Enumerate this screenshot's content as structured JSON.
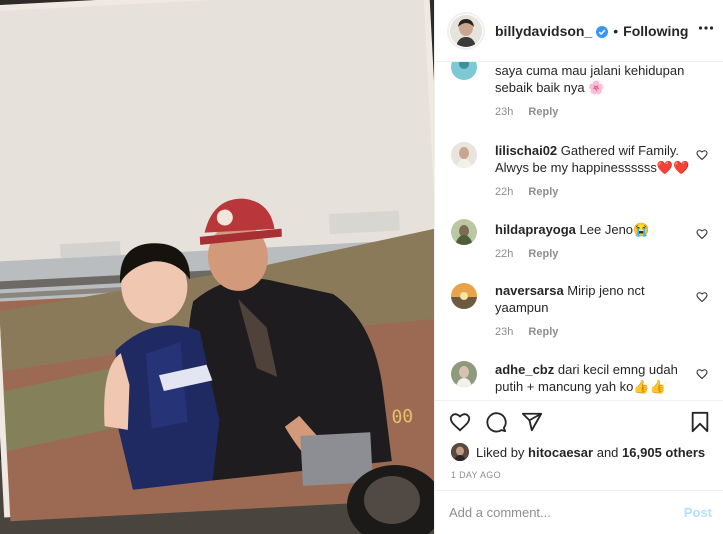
{
  "post": {
    "username": "billydavidson_",
    "follow_status": "Following",
    "separator": "•"
  },
  "comments": [
    {
      "username": "",
      "text": "saya cuma mau jalani kehidupan sebaik baik nya 🌸",
      "time": "23h",
      "reply": "Reply"
    },
    {
      "username": "lilischai02",
      "text": "Gathered wif Family. Alwys be my happinessssss❤️❤️",
      "time": "22h",
      "reply": "Reply"
    },
    {
      "username": "hildaprayoga",
      "text": "Lee Jeno😭",
      "time": "22h",
      "reply": "Reply"
    },
    {
      "username": "naversarsa",
      "text": "Mirip jeno nct yaampun",
      "time": "23h",
      "reply": "Reply"
    },
    {
      "username": "adhe_cbz",
      "text": "dari kecil emng udah putih + mancung yah ko👍👍",
      "time": "",
      "reply": ""
    }
  ],
  "likes": {
    "prefix": "Liked by",
    "user": "hitocaesar",
    "and": "and",
    "count": "16,905 others"
  },
  "time_ago": "1 DAY AGO",
  "comment_box": {
    "placeholder": "Add a comment...",
    "post_label": "Post"
  },
  "photo": {
    "stamp": "00"
  },
  "icons": {
    "verified": "verified-badge-icon",
    "more": "more-options-icon",
    "like": "heart-icon",
    "comment": "comment-icon",
    "share": "share-icon",
    "save": "bookmark-icon"
  },
  "colors": {
    "verified": "#3897f0",
    "post_disabled": "#b2dffc",
    "muted": "#8e8e8e"
  }
}
